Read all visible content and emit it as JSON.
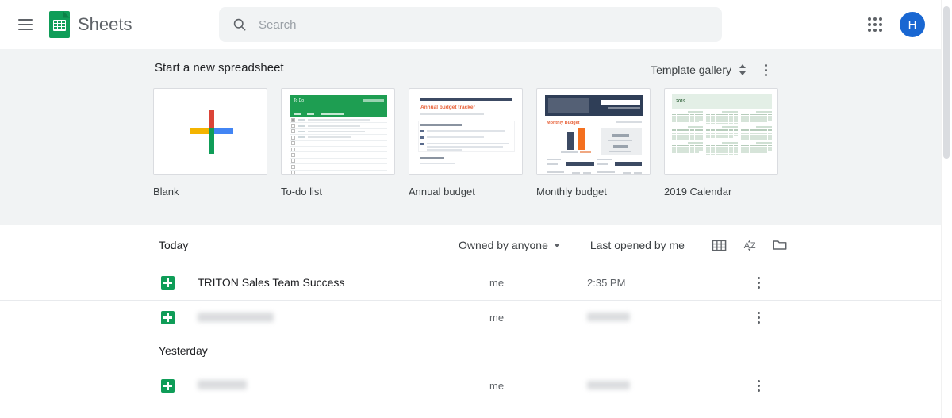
{
  "header": {
    "menu_icon": "hamburger-menu-icon",
    "logo_icon": "google-sheets-logo-icon",
    "brand": "Sheets",
    "search": {
      "icon": "search-icon",
      "placeholder": "Search",
      "value": ""
    },
    "apps_icon": "apps-grid-icon",
    "avatar_initial": "H"
  },
  "templates": {
    "section_title": "Start a new spreadsheet",
    "gallery_label": "Template gallery",
    "gallery_toggle_icon": "chevron-up-down-icon",
    "more_icon": "more-vertical-icon",
    "items": [
      {
        "label": "Blank",
        "thumb": "blank-plus-thumbnail"
      },
      {
        "label": "To-do list",
        "thumb": "todo-list-thumbnail",
        "head_title": "To Do"
      },
      {
        "label": "Annual budget",
        "thumb": "annual-budget-thumbnail",
        "head_title": "Annual budget tracker"
      },
      {
        "label": "Monthly budget",
        "thumb": "monthly-budget-thumbnail",
        "head_title": "Monthly Budget"
      },
      {
        "label": "2019 Calendar",
        "thumb": "calendar-thumbnail",
        "head_title": "2019"
      }
    ]
  },
  "file_list": {
    "toolbar": {
      "group_label": "Today",
      "owner_filter": "Owned by anyone",
      "owner_caret_icon": "chevron-down-icon",
      "sort_label": "Last opened by me",
      "grid_view_icon": "grid-view-icon",
      "sort_az_icon": "sort-az-icon",
      "folder_icon": "folder-icon"
    },
    "groups": [
      {
        "label": "Today",
        "rows": [
          {
            "icon": "sheets-file-icon",
            "name": "TRITON Sales Team Success",
            "owner": "me",
            "date": "2:35 PM",
            "redacted": false,
            "menu_icon": "more-vertical-icon"
          },
          {
            "icon": "sheets-file-icon",
            "name": "redacted",
            "owner": "me",
            "date": "redacted",
            "redacted": true,
            "menu_icon": "more-vertical-icon"
          }
        ]
      },
      {
        "label": "Yesterday",
        "rows": [
          {
            "icon": "sheets-file-icon",
            "name": "redacted",
            "owner": "me",
            "date": "redacted",
            "redacted": true,
            "menu_icon": "more-vertical-icon"
          }
        ]
      }
    ]
  },
  "scrollbar": {
    "name": "vertical-scrollbar"
  },
  "colors": {
    "sheets_green": "#0f9d58",
    "avatar_blue": "#1967d2",
    "section_bg": "#f1f3f4",
    "text_primary": "#202124",
    "text_secondary": "#5f6368",
    "accent_orange": "#e8643c",
    "accent_navy": "#3c4a63"
  }
}
